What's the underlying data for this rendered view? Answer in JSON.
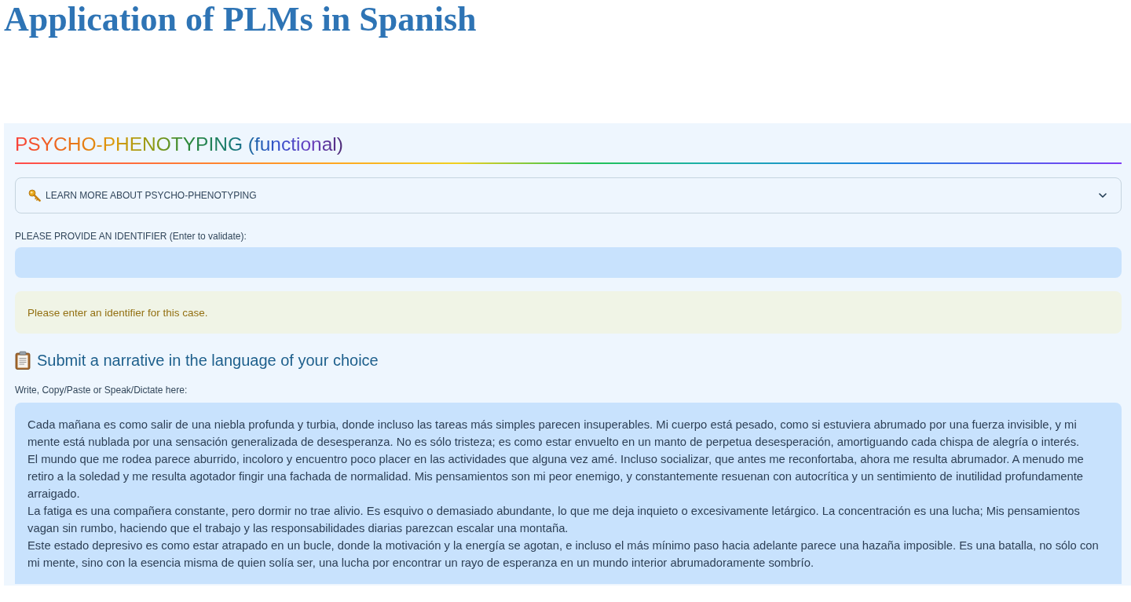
{
  "page": {
    "title": "Application of PLMs in Spanish"
  },
  "section": {
    "title": "PSYCHO-PHENOTYPING (functional)"
  },
  "expander": {
    "label": "LEARN MORE ABOUT PSYCHO-PHENOTYPING",
    "expanded": false
  },
  "identifier": {
    "label": "PLEASE PROVIDE AN IDENTIFIER (Enter to validate):"
  },
  "warning": {
    "text": "Please enter an identifier for this case."
  },
  "narrative": {
    "heading": "Submit a narrative in the language of your choice",
    "label": "Write, Copy/Paste or Speak/Dictate here:",
    "value": "Cada mañana es como salir de una niebla profunda y turbia, donde incluso las tareas más simples parecen insuperables. Mi cuerpo está pesado, como si estuviera abrumado por una fuerza invisible, y mi mente está nublada por una sensación generalizada de desesperanza. No es sólo tristeza; es como estar envuelto en un manto de perpetua desesperación, amortiguando cada chispa de alegría o interés.\nEl mundo que me rodea parece aburrido, incoloro y encuentro poco placer en las actividades que alguna vez amé. Incluso socializar, que antes me reconfortaba, ahora me resulta abrumador. A menudo me retiro a la soledad y me resulta agotador fingir una fachada de normalidad. Mis pensamientos son mi peor enemigo, y constantemente resuenan con autocrítica y un sentimiento de inutilidad profundamente arraigado.\nLa fatiga es una compañera constante, pero dormir no trae alivio. Es esquivo o demasiado abundante, lo que me deja inquieto o excesivamente letárgico. La concentración es una lucha; Mis pensamientos vagan sin rumbo, haciendo que el trabajo y las responsabilidades diarias parezcan escalar una montaña.\nEste estado depresivo es como estar atrapado en un bucle, donde la motivación y la energía se agotan, e incluso el más mínimo paso hacia adelante parece una hazaña imposible. Es una batalla, no sólo con mi mente, sino con la esencia misma de quien solía ser, una lucha por encontrar un rayo de esperanza en un mundo interior abrumadoramente sombrío."
  }
}
